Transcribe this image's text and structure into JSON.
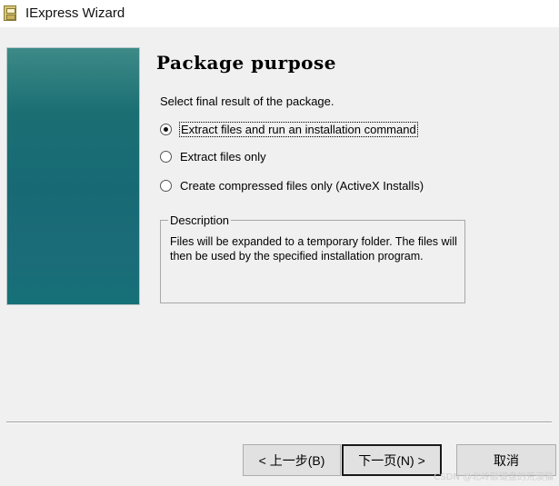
{
  "window": {
    "title": "IExpress Wizard",
    "icon": "iexpress-app-icon"
  },
  "page": {
    "title": "Package purpose",
    "instruction": "Select final result of the package."
  },
  "options": [
    {
      "label": "Extract files and run an installation command",
      "checked": true
    },
    {
      "label": "Extract files only",
      "checked": false
    },
    {
      "label": "Create compressed files only (ActiveX Installs)",
      "checked": false
    }
  ],
  "description": {
    "legend": "Description",
    "text": "Files will be expanded to a temporary folder. The files will then be used by the specified installation program."
  },
  "buttons": {
    "back": "< 上一步(B)",
    "next": "下一页(N) >",
    "cancel": "取消"
  },
  "watermark": "CSDN @北岭敲键盘的荒漠猫",
  "colors": {
    "window_bg": "#f0f0f0",
    "banner_teal": "#1b6f73"
  }
}
